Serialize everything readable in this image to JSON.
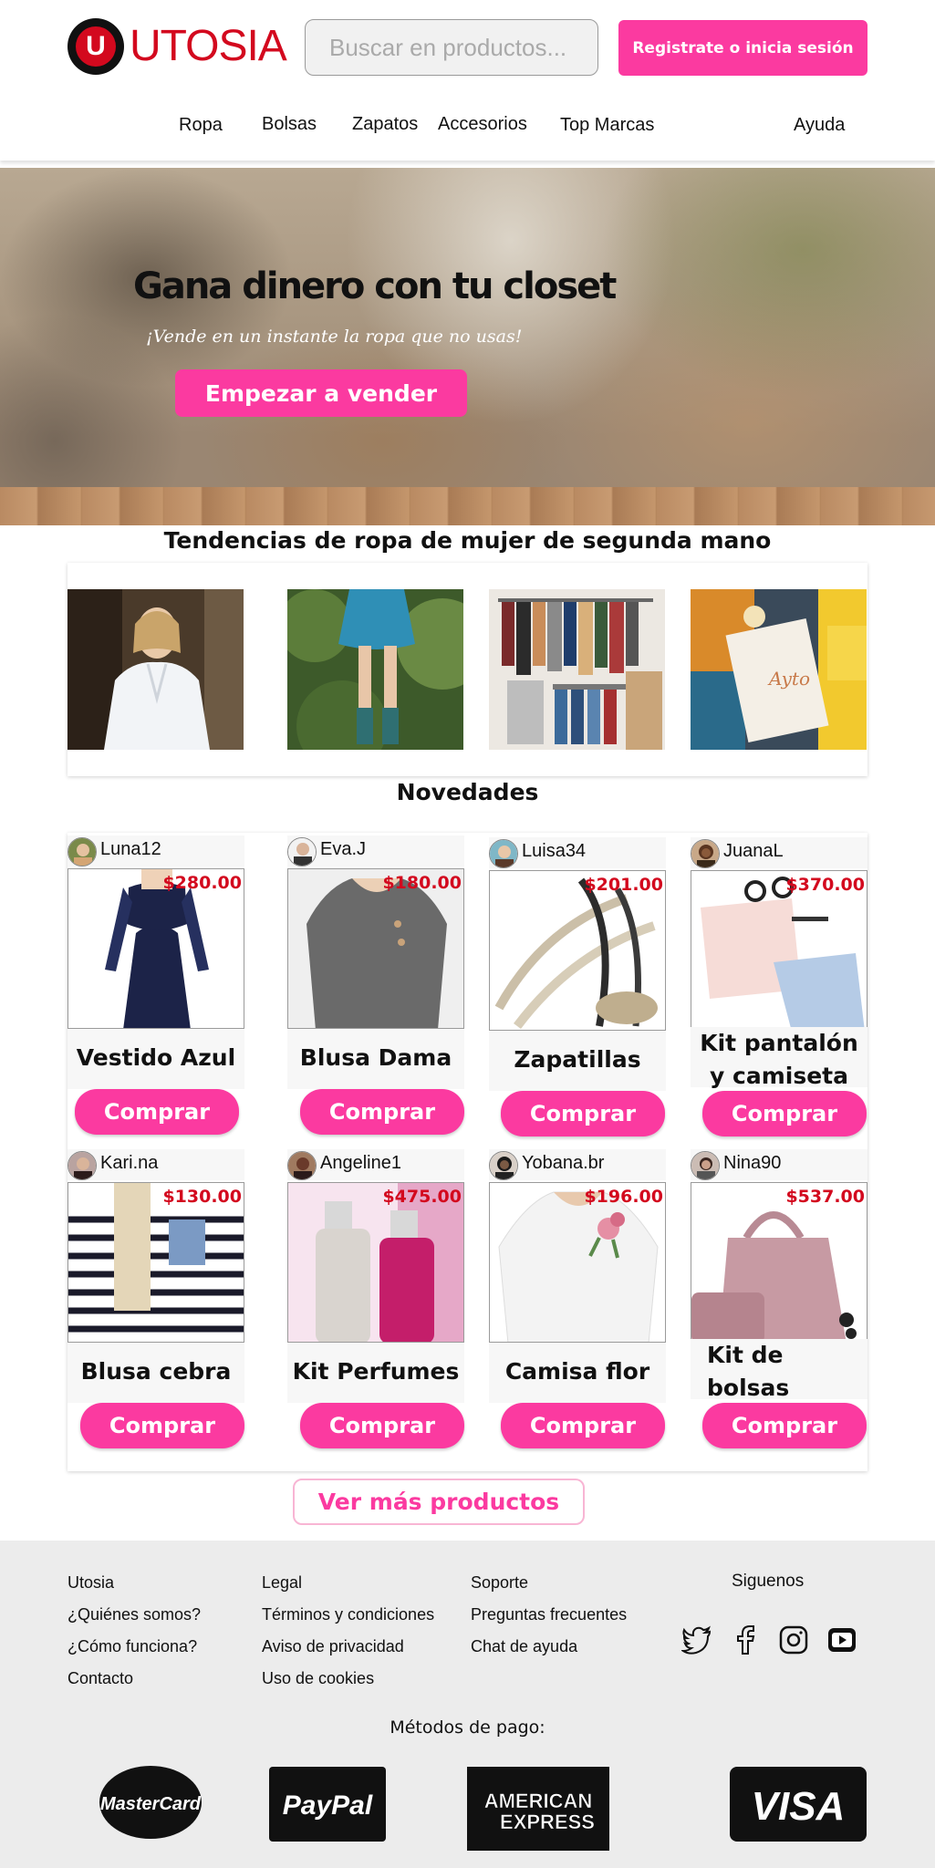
{
  "brand": {
    "logo_letter": "U",
    "logo_text": "UTOSIA",
    "color": "#d3091e"
  },
  "header": {
    "search_placeholder": "Buscar en productos...",
    "login_label": "Registrate o inicia sesión"
  },
  "nav": {
    "items": [
      "Ropa",
      "Bolsas",
      "Zapatos",
      "Accesorios",
      "Top Marcas"
    ],
    "help": "Ayuda"
  },
  "hero": {
    "title": "Gana dinero con tu closet",
    "subtitle": "¡Vende en un instante la ropa que no usas!",
    "cta": "Empezar a vender"
  },
  "trends": {
    "title": "Tendencias de ropa de mujer de segunda mano"
  },
  "news": {
    "title": "Novedades",
    "buy_label": "Comprar",
    "products": [
      {
        "user": "Luna12",
        "price": "$280.00",
        "name": "Vestido Azul"
      },
      {
        "user": "Eva.J",
        "price": "$180.00",
        "name": "Blusa Dama"
      },
      {
        "user": "Luisa34",
        "price": "$201.00",
        "name": "Zapatillas"
      },
      {
        "user": "JuanaL",
        "price": "$370.00",
        "name": "Kit pantalón y camiseta"
      },
      {
        "user": "Kari.na",
        "price": "$130.00",
        "name": "Blusa cebra"
      },
      {
        "user": "Angeline1",
        "price": "$475.00",
        "name": "Kit Perfumes"
      },
      {
        "user": "Yobana.br",
        "price": "$196.00",
        "name": "Camisa flor"
      },
      {
        "user": "Nina90",
        "price": "$537.00",
        "name": "Kit de bolsas dama"
      }
    ]
  },
  "more_label": "Ver más productos",
  "footer": {
    "col1": [
      "Utosia",
      "¿Quiénes somos?",
      "¿Cómo funciona?",
      "Contacto"
    ],
    "col2": [
      "Legal",
      "Términos y condiciones",
      "Aviso de privacidad",
      "Uso de cookies"
    ],
    "col3": [
      "Soporte",
      "Preguntas frecuentes",
      "Chat de ayuda"
    ],
    "social_title": "Siguenos",
    "social_icons": [
      "twitter-icon",
      "facebook-icon",
      "instagram-icon",
      "youtube-icon"
    ],
    "payments_title": "Métodos de pago:",
    "payments": {
      "mastercard": "MasterCard",
      "paypal": "PayPal",
      "amex_line1": "AMERICAN",
      "amex_line2": "EXPRESS",
      "visa": "VISA"
    }
  },
  "colors": {
    "accent": "#fb3aa0",
    "price": "#d3091e",
    "footer_bg": "#ececec"
  }
}
